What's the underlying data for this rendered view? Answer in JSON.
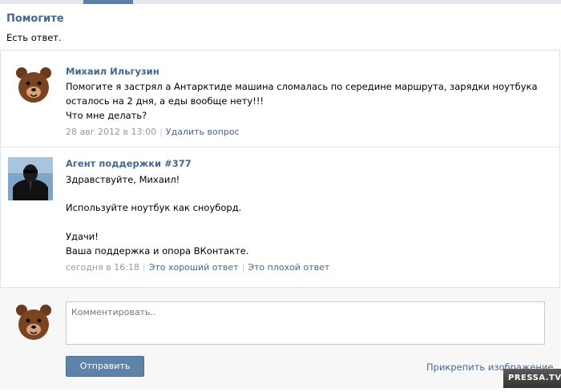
{
  "page": {
    "title": "Помогите",
    "subtitle": "Есть ответ."
  },
  "question": {
    "author": "Михаил Ильгузин",
    "lines": [
      "Помогите я застрял а Антарктиде машина сломалась по середине маршрута, зарядки ноутбука",
      "осталось на 2 дня, а еды вообще нету!!!",
      "Что мне делать?"
    ],
    "date": "28 авг 2012 в 13:00",
    "delete_link": "Удалить вопрос",
    "avatar_icon": "bear-avatar-icon"
  },
  "answer": {
    "author": "Агент поддержки #377",
    "lines": [
      "Здравствуйте, Михаил!",
      "Используйте ноутбук как сноуборд.",
      "Удачи!",
      "Ваша поддержка и опора ВКонтакте."
    ],
    "date": "сегодня в 16:18",
    "good_link": "Это хороший ответ",
    "bad_link": "Это плохой ответ",
    "avatar_icon": "agent-avatar-icon"
  },
  "comment": {
    "placeholder": "Комментировать..",
    "send_label": "Отправить",
    "attach_label": "Прикрепить изображение"
  },
  "watermark": "PRESSA.TV",
  "colors": {
    "link": "#45688e",
    "button": "#5e82a8",
    "meta": "#999999"
  }
}
